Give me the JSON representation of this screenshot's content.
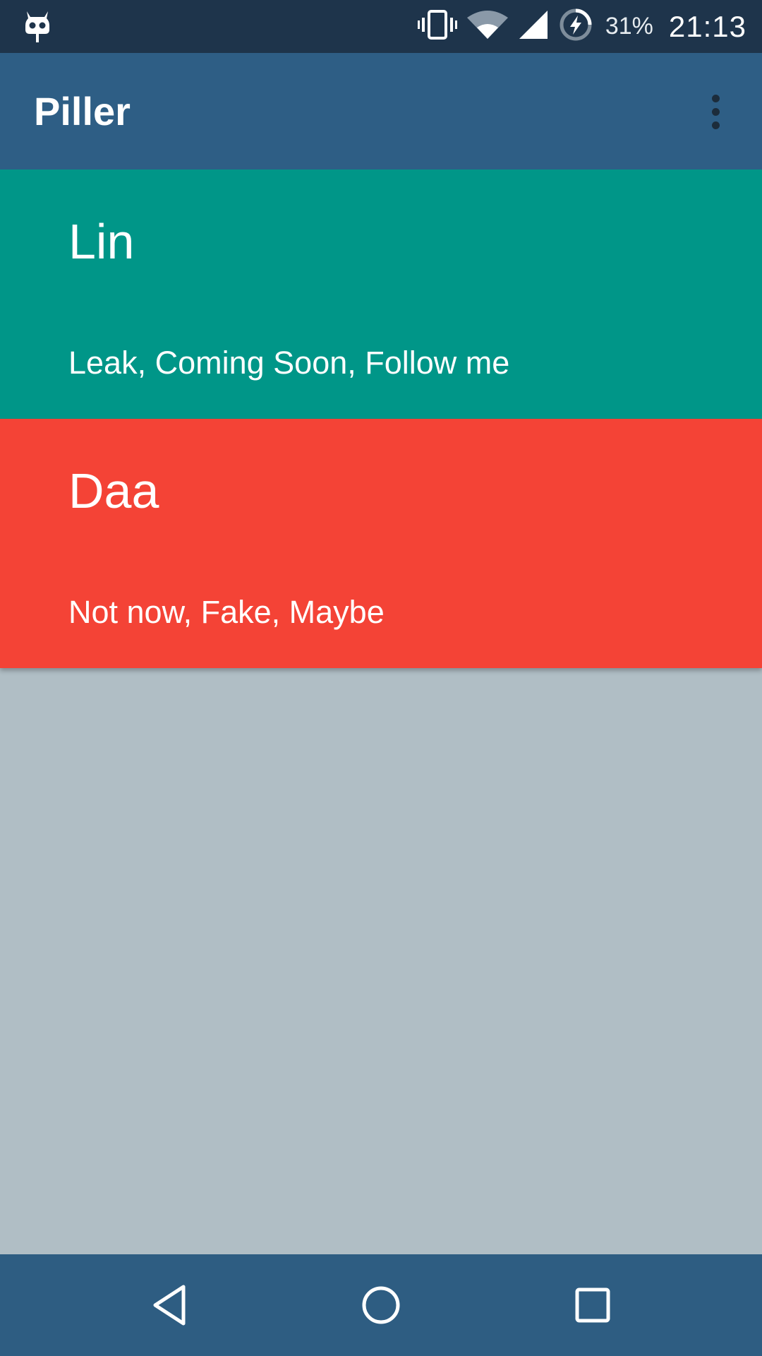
{
  "status_bar": {
    "notification_icon": "cyanogenmod-mascot-icon",
    "icons": [
      "vibrate-icon",
      "wifi-icon",
      "cell-signal-icon",
      "battery-charging-icon"
    ],
    "battery_percent": "31%",
    "time": "21:13"
  },
  "app_bar": {
    "title": "Piller",
    "menu_icon": "overflow-menu-icon"
  },
  "cards": [
    {
      "title": "Lin",
      "subtitle": "Leak, Coming Soon, Follow me",
      "color": "#009688"
    },
    {
      "title": "Daa",
      "subtitle": "Not now, Fake, Maybe",
      "color": "#f44336"
    }
  ],
  "colors": {
    "status_bar": "#1e344b",
    "app_bar": "#2e5e85",
    "background": "#b0bec5",
    "nav_bar": "#2e5d82"
  },
  "nav_bar": {
    "buttons": [
      "back-icon",
      "home-icon",
      "recents-icon"
    ]
  }
}
